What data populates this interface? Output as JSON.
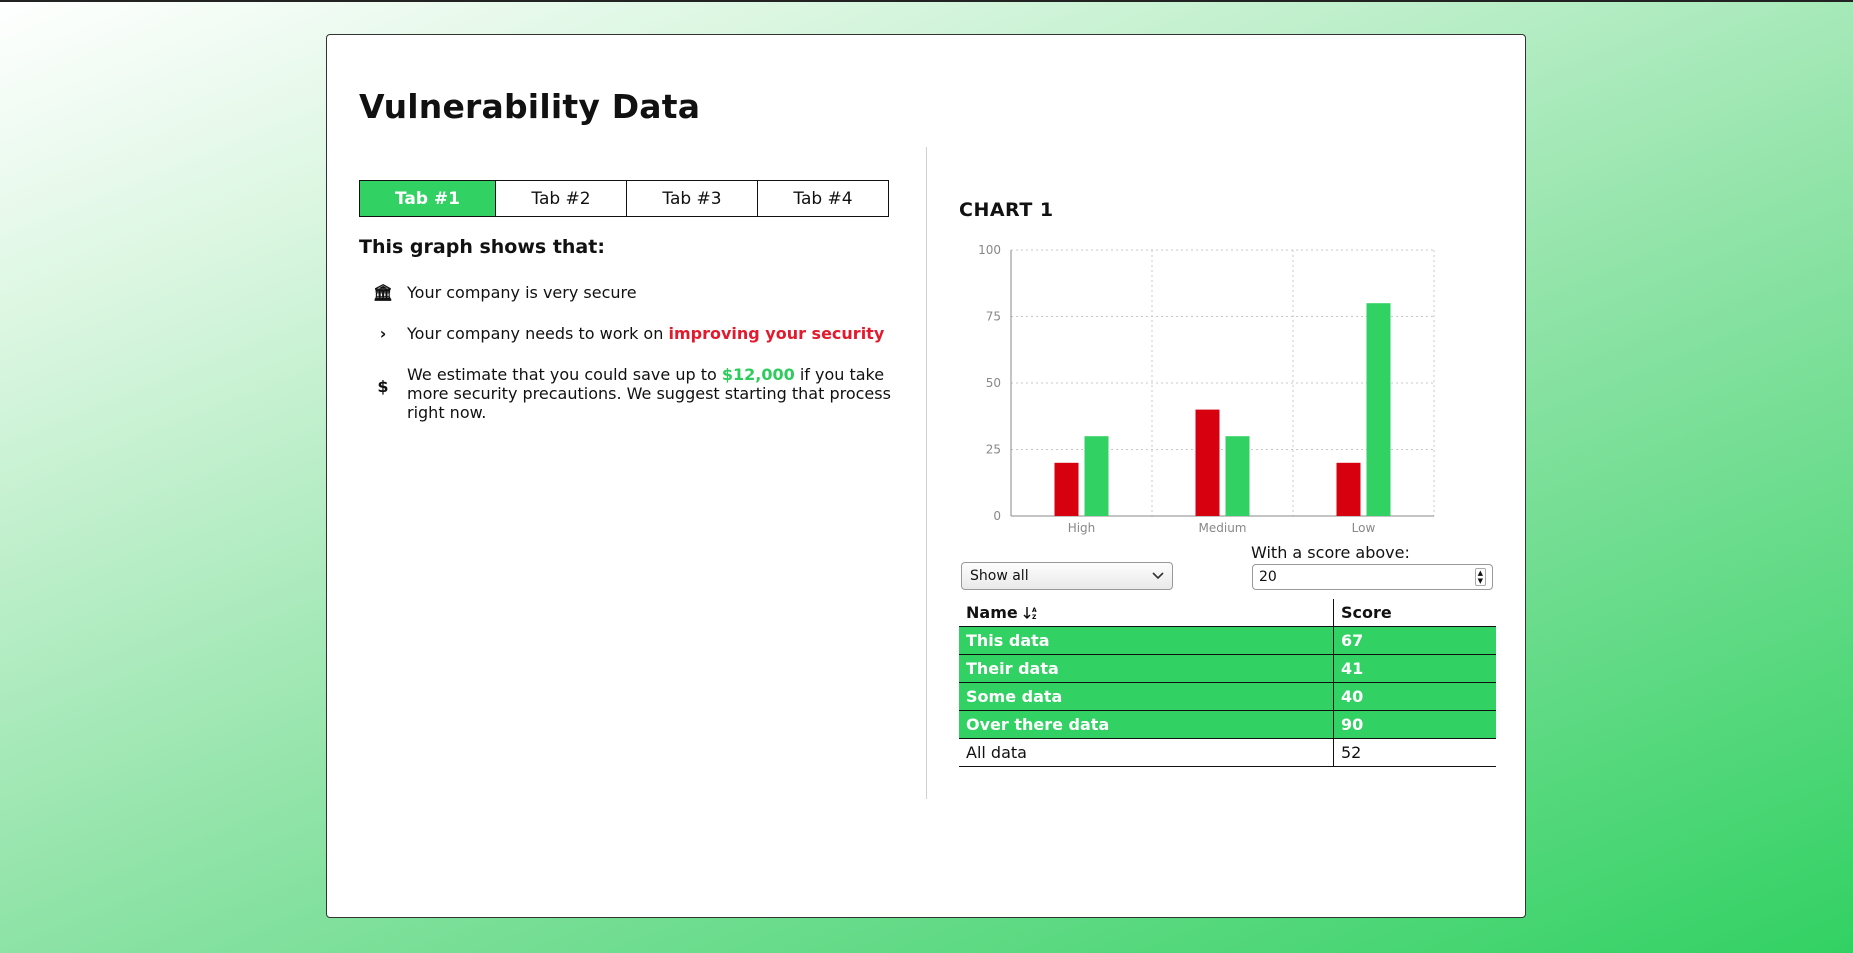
{
  "page": {
    "title": "Vulnerability Data"
  },
  "tabs": [
    "Tab #1",
    "Tab #2",
    "Tab #3",
    "Tab #4"
  ],
  "summary": {
    "heading": "This graph shows that:",
    "items": [
      {
        "icon": "bank-icon",
        "glyph": "🏛",
        "text": "Your company is very secure"
      },
      {
        "icon": "chevron-right-icon",
        "glyph": "›",
        "text": "Your company needs to work on ",
        "highlight": "improving your security"
      },
      {
        "icon": "dollar-icon",
        "glyph": "$",
        "text": "We estimate that you could save up to ",
        "highlight": "$12,000",
        "text_after": " if you take more security precautions. We suggest starting that process right now."
      }
    ]
  },
  "chart": {
    "title": "CHART 1"
  },
  "chart_data": {
    "type": "bar",
    "categories": [
      "High",
      "Medium",
      "Low"
    ],
    "series": [
      {
        "values": [
          20,
          40,
          20
        ],
        "color": "#d6000f"
      },
      {
        "values": [
          30,
          30,
          80
        ],
        "color": "#32d163"
      }
    ],
    "ylim": [
      0,
      100
    ],
    "yticks": [
      0,
      25,
      50,
      75,
      100
    ],
    "grid": true
  },
  "filter": {
    "selected": "Show all"
  },
  "score_filter": {
    "label": "With a score above:",
    "value": "20"
  },
  "table": {
    "headers": {
      "name": "Name",
      "score": "Score"
    },
    "rows": [
      {
        "name": "This data",
        "score": "67",
        "highlighted": true
      },
      {
        "name": "Their data",
        "score": "41",
        "highlighted": true
      },
      {
        "name": "Some data",
        "score": "40",
        "highlighted": true
      },
      {
        "name": "Over there data",
        "score": "90",
        "highlighted": true
      },
      {
        "name": "All data",
        "score": "52",
        "highlighted": false
      }
    ]
  },
  "colors": {
    "accent": "#32d163",
    "danger": "#d6000f",
    "highlight_red": "#e31a2d"
  }
}
